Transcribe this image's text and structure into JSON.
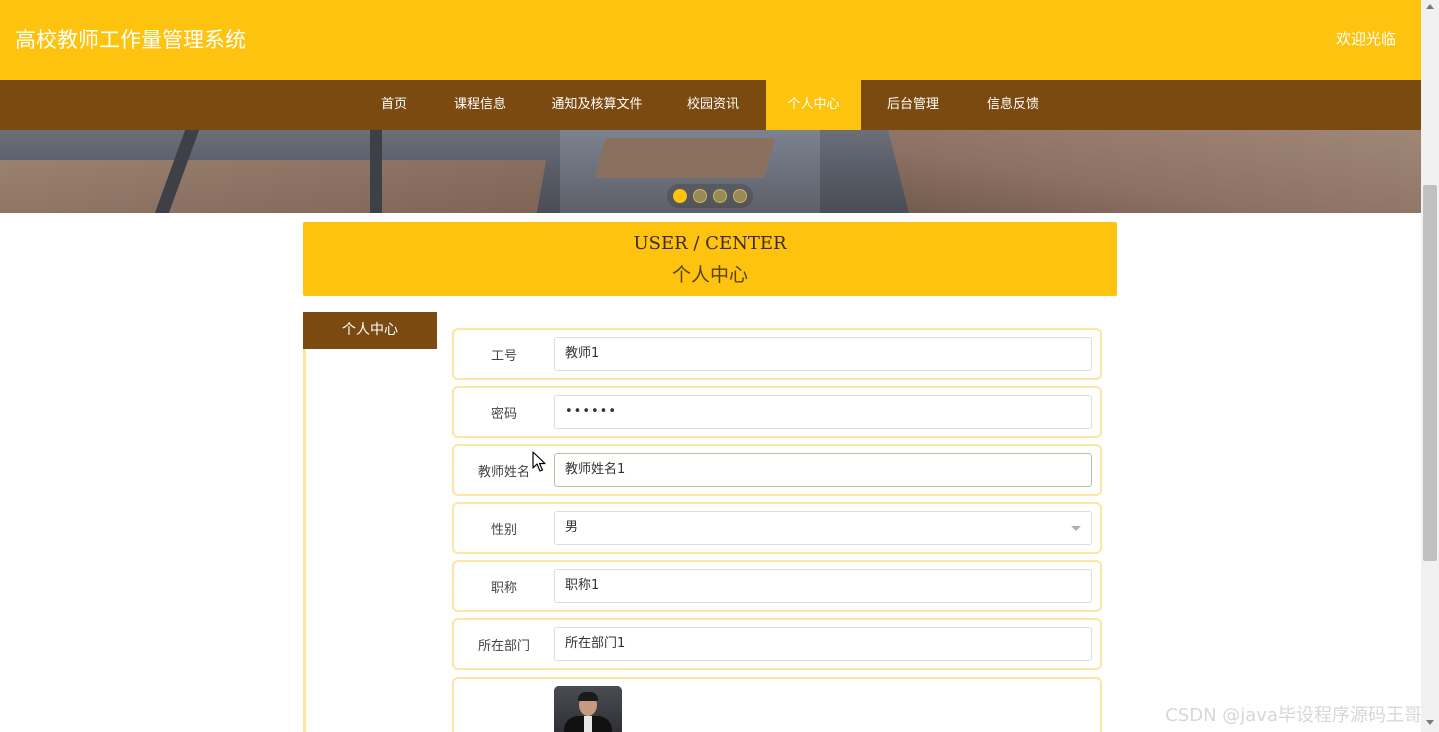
{
  "header": {
    "site_title": "高校教师工作量管理系统",
    "welcome": "欢迎光临"
  },
  "nav": {
    "items": [
      {
        "label": "首页"
      },
      {
        "label": "课程信息"
      },
      {
        "label": "通知及核算文件"
      },
      {
        "label": "校园资讯"
      },
      {
        "label": "个人中心",
        "active": true
      },
      {
        "label": "后台管理"
      },
      {
        "label": "信息反馈"
      }
    ]
  },
  "banner": {
    "slide_count": 4,
    "active_slide": 1
  },
  "section": {
    "title_en": "USER / CENTER",
    "title_cn": "个人中心"
  },
  "sidebar": {
    "items": [
      {
        "label": "个人中心"
      }
    ]
  },
  "form": {
    "fields": [
      {
        "label": "工号",
        "value": "教师1"
      },
      {
        "label": "密码",
        "value": "••••••"
      },
      {
        "label": "教师姓名",
        "value": "教师姓名1"
      },
      {
        "label": "性别",
        "value": "男"
      },
      {
        "label": "职称",
        "value": "职称1"
      },
      {
        "label": "所在部门",
        "value": "所在部门1"
      }
    ],
    "avatar": "teacher-photo"
  },
  "watermark": "CSDN @java毕设程序源码王哥",
  "colors": {
    "brand_yellow": "#fdc30e",
    "nav_brown": "#7a4a10",
    "border_light_yellow": "#fde6a2"
  }
}
